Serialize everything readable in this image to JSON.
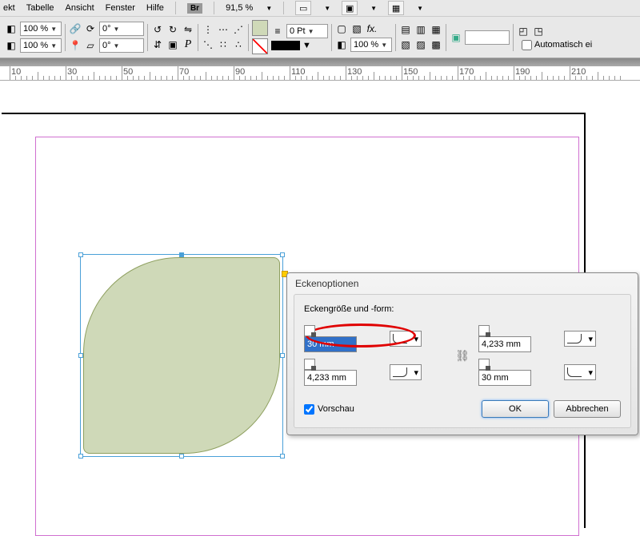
{
  "menu": {
    "items": [
      "ekt",
      "Tabelle",
      "Ansicht",
      "Fenster",
      "Hilfe"
    ],
    "br": "Br",
    "zoom": "91,5 %"
  },
  "toolbar": {
    "opacity1": "100 %",
    "opacity2": "100 %",
    "angle": "0°",
    "stroke_weight": "0 Pt",
    "stroke_opacity": "100 %",
    "auto_label": "Automatisch ei"
  },
  "ruler_ticks": [
    10,
    30,
    50,
    70,
    90,
    110,
    130,
    150,
    170,
    190,
    210
  ],
  "dialog": {
    "title": "Eckenoptionen",
    "section": "Eckengröße und -form:",
    "tl": "30 mm",
    "tr": "4,233 mm",
    "bl": "4,233 mm",
    "br": "30 mm",
    "preview": "Vorschau",
    "ok": "OK",
    "cancel": "Abbrechen"
  }
}
